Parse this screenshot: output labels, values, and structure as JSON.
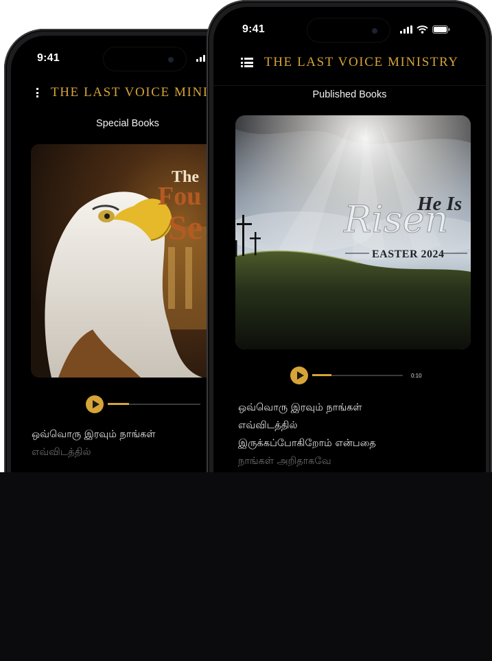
{
  "phones": [
    {
      "status": {
        "time": "9:41"
      },
      "brand": "THE LAST VOICE MINISTRY",
      "section": "Special Books",
      "cover": {
        "type": "eagle-book-cover",
        "title_lines": [
          "The",
          "Fou",
          "Se"
        ]
      },
      "player": {
        "progress": 0.23,
        "time": ""
      },
      "lyrics": [
        "ஒவ்வொரு இரவும் நாங்கள்",
        "எவ்விடத்தில்"
      ]
    },
    {
      "status": {
        "time": "9:41"
      },
      "brand": "THE LAST VOICE MINISTRY",
      "section": "Published Books",
      "cover": {
        "type": "easter-cover",
        "line1": "He Is",
        "line2": "Risen",
        "line3": "EASTER 2024"
      },
      "player": {
        "progress": 0.21,
        "time": "0:10"
      },
      "lyrics": [
        "ஒவ்வொரு இரவும் நாங்கள்",
        "எவ்விடத்தில்",
        "இருக்கப்போகிறோம் என்பதை",
        "நாங்கள் அறிதாகவே"
      ]
    }
  ],
  "colors": {
    "accent": "#d6a437",
    "background": "#000000",
    "page": "#0b0b0d"
  },
  "icons": [
    "menu-icon",
    "signal-icon",
    "wifi-icon",
    "battery-icon",
    "play-icon"
  ]
}
